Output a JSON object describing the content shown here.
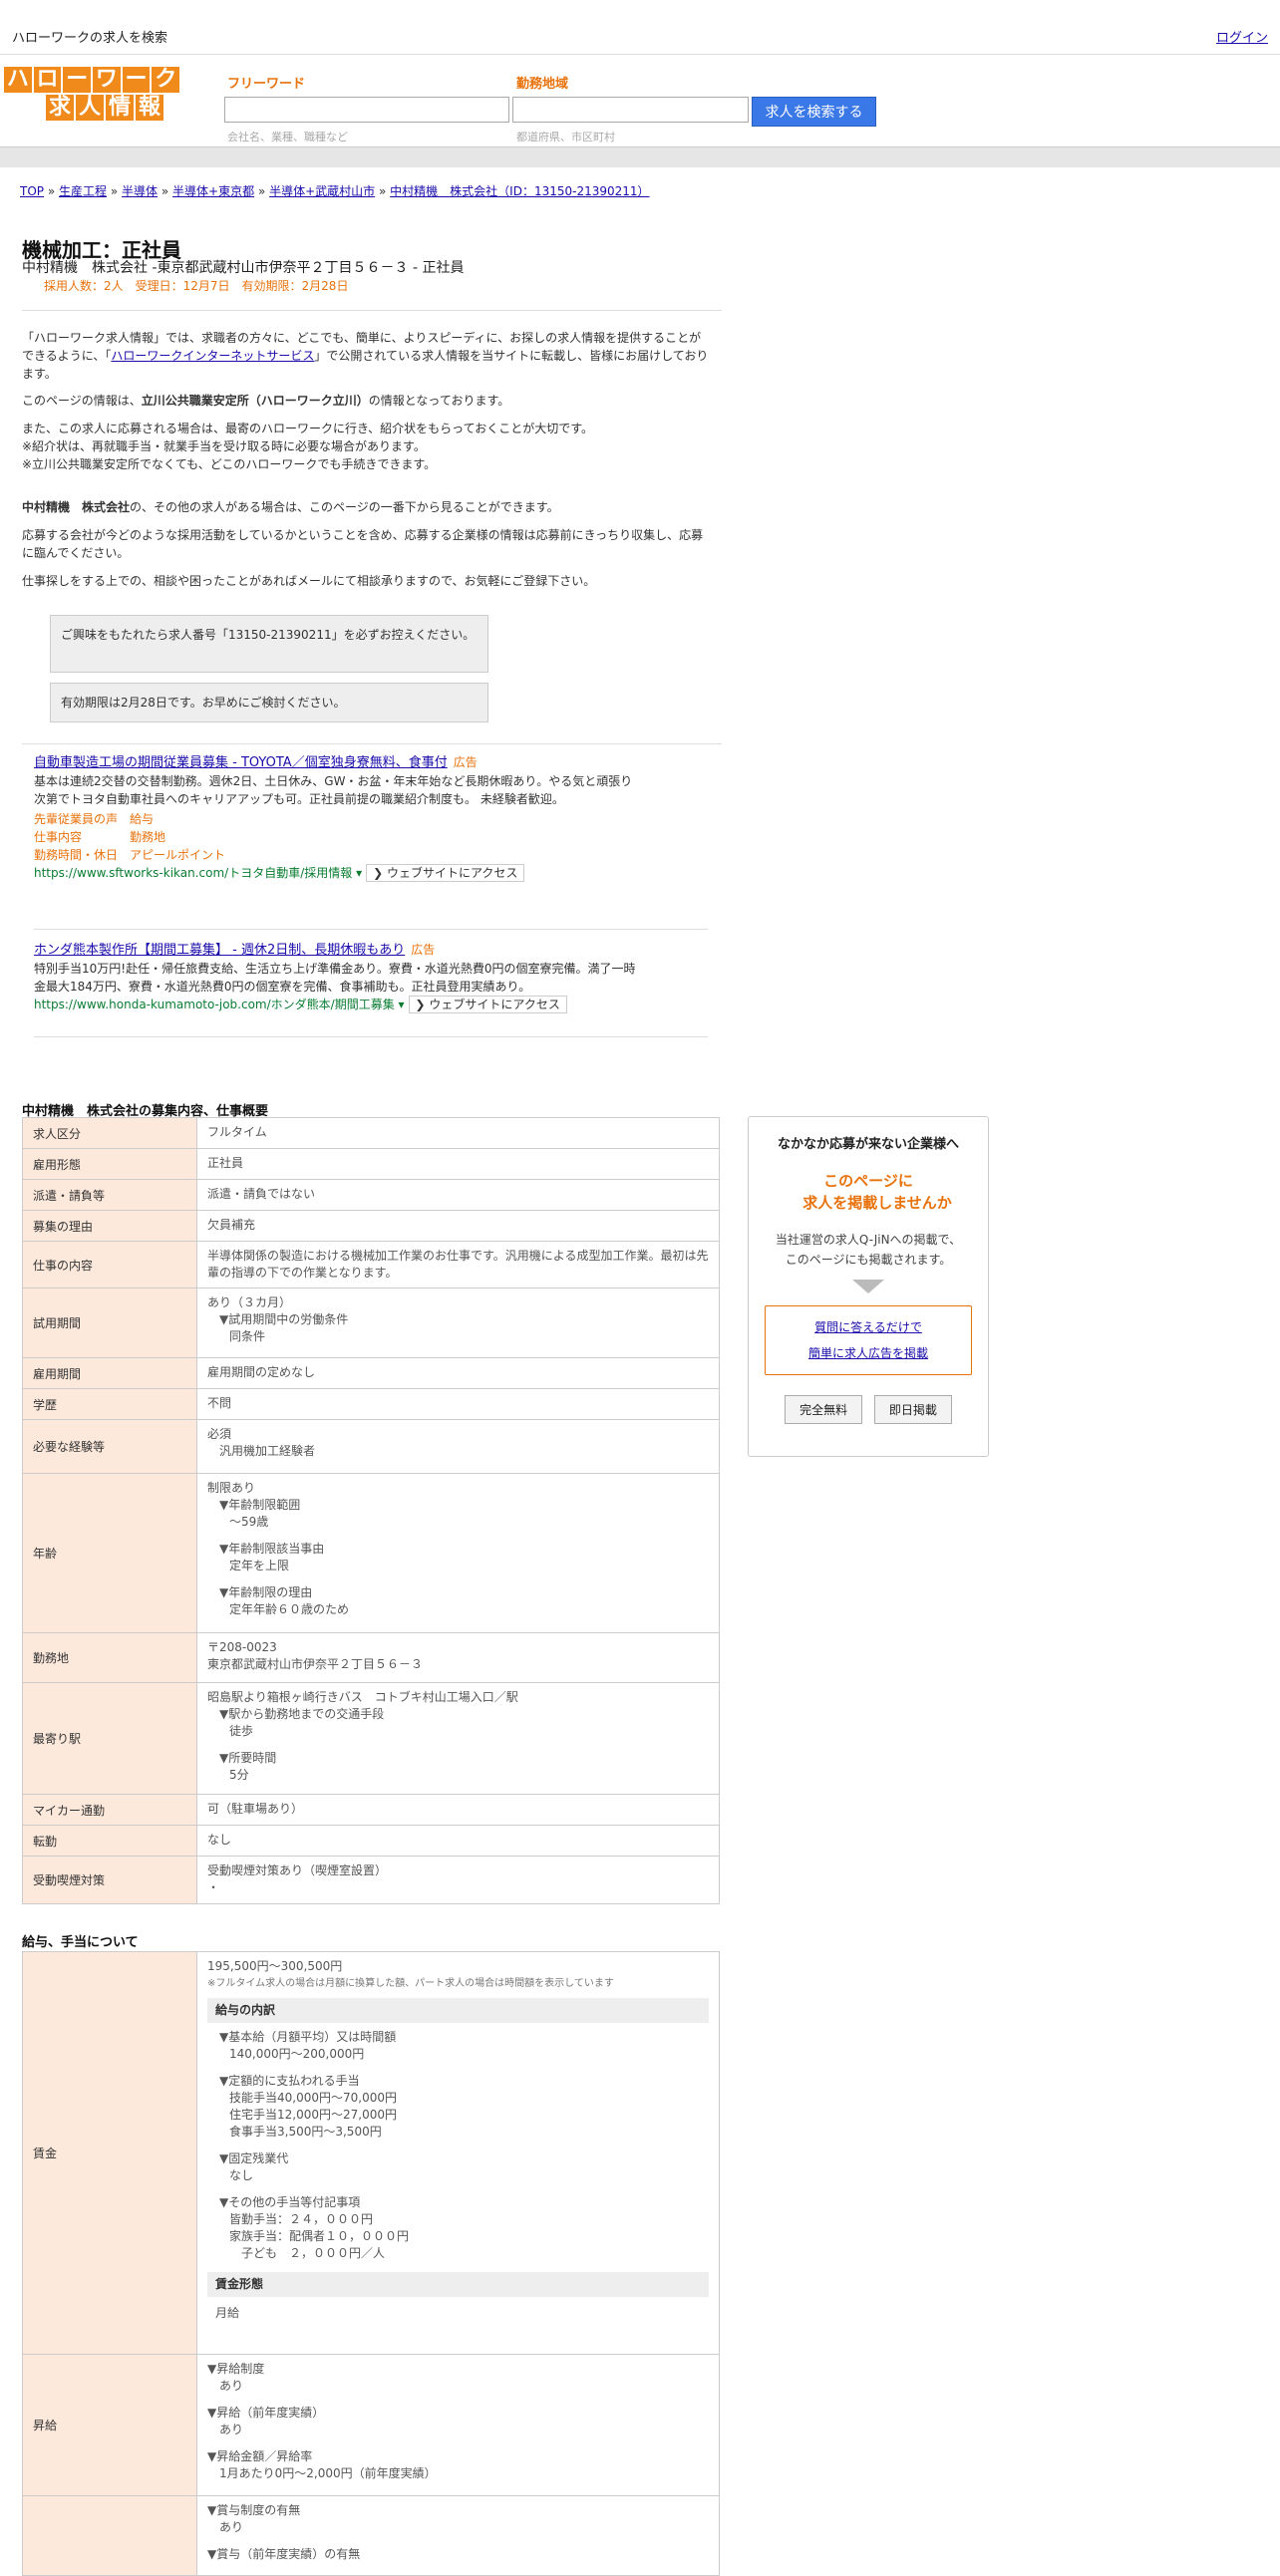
{
  "header": {
    "site_title": "ハローワークの求人を検索",
    "login": "ログイン"
  },
  "logo": {
    "row1": [
      "ハ",
      "ロ",
      "ー",
      "ワ",
      "ー",
      "ク"
    ],
    "row2": [
      "求",
      "人",
      "情",
      "報"
    ]
  },
  "search": {
    "keyword_label": "フリーワード",
    "keyword_hint": "会社名、業種、職種など",
    "area_label": "勤務地域",
    "area_hint": "都道府県、市区町村",
    "button": "求人を検索する"
  },
  "breadcrumb": {
    "items": [
      "TOP",
      "生産工程",
      "半導体",
      "半導体+東京都",
      "半導体+武蔵村山市",
      "中村精機　株式会社（ID：13150-21390211）"
    ],
    "sep": "»"
  },
  "job": {
    "title": "機械加工：正社員",
    "subtitle": "中村精機　株式会社 -東京都武蔵村山市伊奈平２丁目５６－３ - 正社員",
    "meta": "採用人数：2人　受理日：12月7日　有効期限：2月28日"
  },
  "intro": {
    "p1_a": "「ハローワーク求人情報」では、求職者の方々に、どこでも、簡単に、よりスピーディに、お探しの求人情報を提供することができるように、「",
    "p1_link": "ハローワークインターネットサービス",
    "p1_b": "」で公開されている求人情報を当サイトに転載し、皆様にお届けしております。",
    "p2_a": "このページの情報は、",
    "p2_bold": "立川公共職業安定所（ハローワーク立川）",
    "p2_b": "の情報となっております。",
    "p3_l1": "また、この求人に応募される場合は、最寄のハローワークに行き、紹介状をもらっておくことが大切です。",
    "p3_l2": "※紹介状は、再就職手当・就業手当を受け取る時に必要な場合があります。",
    "p3_l3": "※立川公共職業安定所でなくても、どこのハローワークでも手続きできます。",
    "p4_bold": "中村精機　株式会社",
    "p4_rest": "の、その他の求人がある場合は、このページの一番下から見ることができます。",
    "p5": "応募する会社が今どのような採用活動をしているかということを含め、応募する企業様の情報は応募前にきっちり収集し、応募に臨んでください。",
    "p6": "仕事探しをする上での、相談や困ったことがあればメールにて相談承りますので、お気軽にご登録下さい。"
  },
  "notices": {
    "n1": "ご興味をもたれたら求人番号「13150-21390211」を必ずお控えください。",
    "n2": "有効期限は2月28日です。お早めにご検討ください。"
  },
  "ads": [
    {
      "title": "自動車製造工場の期間従業員募集 - TOYOTA／個室独身寮無料、食事付",
      "badge": "広告",
      "body": "基本は連続2交替の交替制勤務。週休2日、土日休み、GW・お盆・年末年始など長期休暇あり。やる気と頑張り次第でトヨタ自動車社員へのキャリアアップも可。正社員前提の職業紹介制度も。 未経験者歓迎。",
      "links_r1": "先輩従業員の声　給与",
      "links_r2": "仕事内容　　　　勤務地",
      "links_r3": "勤務時間・休日　アピールポイント",
      "url": "https://www.sftworks-kikan.com/トヨタ自動車/採用情報 ▾",
      "button": "❯ ウェブサイトにアクセス"
    },
    {
      "title": "ホンダ熊本製作所【期間工募集】 - 週休2日制、長期休暇もあり",
      "badge": "広告",
      "body": "特別手当10万円!赴任・帰任旅費支給、生活立ち上げ準備金あり。寮費・水道光熱費0円の個室寮完備。満了一時金最大184万円、寮費・水道光熱費0円の個室寮を完備、食事補助も。正社員登用実績あり。",
      "url": "https://www.honda-kumamoto-job.com/ホンダ熊本/期間工募集 ▾",
      "button": "❯ ウェブサイトにアクセス"
    }
  ],
  "summary": {
    "heading": "中村精機　株式会社の募集内容、仕事概要",
    "rows": {
      "r1": {
        "th": "求人区分",
        "td": "フルタイム"
      },
      "r2": {
        "th": "雇用形態",
        "td": "正社員"
      },
      "r3": {
        "th": "派遣・請負等",
        "td": "派遣・請負ではない"
      },
      "r4": {
        "th": "募集の理由",
        "td": "欠員補充"
      },
      "r5": {
        "th": "仕事の内容",
        "td": "半導体関係の製造における機械加工作業のお仕事です。汎用機による成型加工作業。最初は先輩の指導の下での作業となります。"
      },
      "r6": {
        "th": "試用期間",
        "l1": "あり（３カ月）",
        "l2": "▼試用期間中の労働条件",
        "l3": "同条件"
      },
      "r7": {
        "th": "雇用期間",
        "td": "雇用期間の定めなし"
      },
      "r8": {
        "th": "学歴",
        "td": "不問"
      },
      "r9": {
        "th": "必要な経験等",
        "l1": "必須",
        "l2": "汎用機加工経験者"
      },
      "r10": {
        "th": "年齢",
        "l1": "制限あり",
        "l2": "▼年齢制限範囲",
        "l3": "〜59歳",
        "l4": "▼年齢制限該当事由",
        "l5": "定年を上限",
        "l6": "▼年齢制限の理由",
        "l7": "定年年齢６０歳のため"
      },
      "r11": {
        "th": "勤務地",
        "l1": "〒208-0023",
        "l2": "東京都武蔵村山市伊奈平２丁目５６－３"
      },
      "r12": {
        "th": "最寄り駅",
        "l1": "昭島駅より箱根ヶ崎行きバス　コトブキ村山工場入口／駅",
        "l2": "▼駅から勤務地までの交通手段",
        "l3": "徒歩",
        "l4": "▼所要時間",
        "l5": "5分"
      },
      "r13": {
        "th": "マイカー通勤",
        "td": "可（駐車場あり）"
      },
      "r14": {
        "th": "転勤",
        "td": "なし"
      },
      "r15": {
        "th": "受動喫煙対策",
        "l1": "受動喫煙対策あり（喫煙室設置）",
        "l2": "・"
      }
    }
  },
  "pay": {
    "heading": "給与、手当について",
    "wage_th": "賃金",
    "wage_range": "195,500円〜300,500円",
    "wage_note": "※フルタイム求人の場合は月額に換算した額、パート求人の場合は時間額を表示しています",
    "breakdown_head": "給与の内訳",
    "b1": "▼基本給（月額平均）又は時間額",
    "b1v": "140,000円〜200,000円",
    "b2": "▼定額的に支払われる手当",
    "b2v1": "技能手当40,000円〜70,000円",
    "b2v2": "住宅手当12,000円〜27,000円",
    "b2v3": "食事手当3,500円〜3,500円",
    "b3": "▼固定残業代",
    "b3v": "なし",
    "b4": "▼その他の手当等付記事項",
    "b4v1": "皆勤手当：２４，０００円",
    "b4v2": "家族手当：配偶者１０，０００円",
    "b4v3": "子ども　２，０００円／人",
    "form_head": "賃金形態",
    "form_val": "月給",
    "raise_th": "昇給",
    "r1": "▼昇給制度",
    "r1v": "あり",
    "r2": "▼昇給（前年度実績）",
    "r2v": "あり",
    "r3": "▼昇給金額／昇給率",
    "r3v": "1月あたり0円〜2,000円（前年度実績）",
    "bonus_l1": "▼賞与制度の有無",
    "bonus_l1v": "あり",
    "bonus_l2": "▼賞与（前年度実績）の有無"
  },
  "side": {
    "title": "なかなか応募が来ない企業様へ",
    "lead1": "このページに",
    "lead2": "求人を掲載しませんか",
    "text1": "当社運営の求人Q-JiNへの掲載で、",
    "text2": "このページにも掲載されます。",
    "cta1": "質問に答えるだけで",
    "cta2": "簡単に求人広告を掲載",
    "btn1": "完全無料",
    "btn2": "即日掲載"
  }
}
